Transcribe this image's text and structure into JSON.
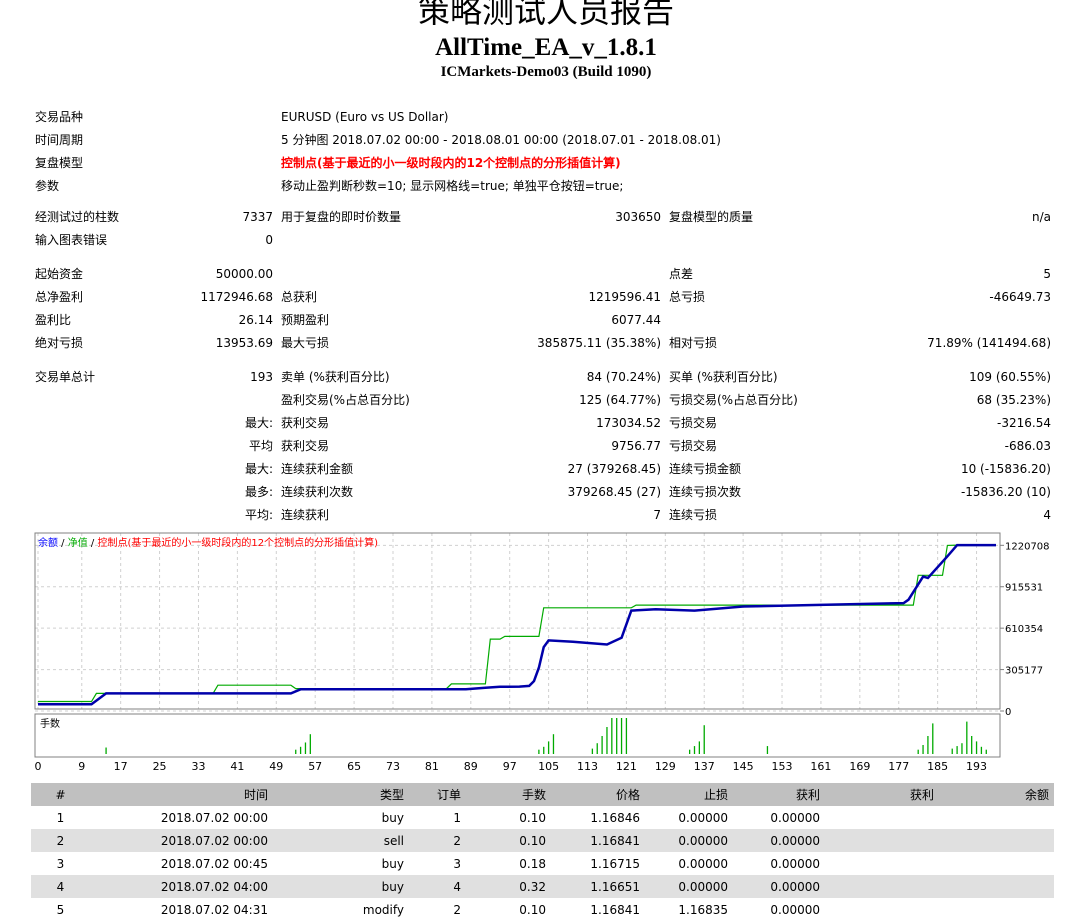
{
  "header": {
    "title": "策略测试人员报告",
    "ea_name": "AllTime_EA_v_1.8.1",
    "server": "ICMarkets-Demo03 (Build 1090)"
  },
  "info": {
    "symbol_label": "交易品种",
    "symbol_value": "EURUSD (Euro vs US Dollar)",
    "period_label": "时间周期",
    "period_value": "5 分钟图 2018.07.02 00:00 - 2018.08.01 00:00 (2018.07.01 - 2018.08.01)",
    "model_label": "复盘模型",
    "model_value": "控制点(基于最近的小一级时段内的12个控制点的分形插值计算)",
    "params_label": "参数",
    "params_value": "移动止盈判断秒数=10; 显示网格线=true; 单独平仓按钮=true;"
  },
  "stats": {
    "bars_label": "经测试过的柱数",
    "bars_value": "7337",
    "ticks_label": "用于复盘的即时价数量",
    "ticks_value": "303650",
    "quality_label": "复盘模型的质量",
    "quality_value": "n/a",
    "errors_label": "输入图表错误",
    "errors_value": "0",
    "deposit_label": "起始资金",
    "deposit_value": "50000.00",
    "spread_label": "点差",
    "spread_value": "5",
    "net_label": "总净盈利",
    "net_value": "1172946.68",
    "gross_profit_label": "总获利",
    "gross_profit_value": "1219596.41",
    "gross_loss_label": "总亏损",
    "gross_loss_value": "-46649.73",
    "pf_label": "盈利比",
    "pf_value": "26.14",
    "payoff_label": "预期盈利",
    "payoff_value": "6077.44",
    "abs_dd_label": "绝对亏损",
    "abs_dd_value": "13953.69",
    "max_dd_label": "最大亏损",
    "max_dd_value": "385875.11 (35.38%)",
    "rel_dd_label": "相对亏损",
    "rel_dd_value": "71.89% (141494.68)",
    "total_label": "交易单总计",
    "total_value": "193",
    "short_label": "卖单 (%获利百分比)",
    "short_value": "84 (70.24%)",
    "long_label": "买单 (%获利百分比)",
    "long_value": "109 (60.55%)",
    "profit_trades_label": "盈利交易(%占总百分比)",
    "profit_trades_value": "125 (64.77%)",
    "loss_trades_label": "亏损交易(%占总百分比)",
    "loss_trades_value": "68 (35.23%)",
    "largest_prefix": "最大:",
    "largest_profit_label": "获利交易",
    "largest_profit_value": "173034.52",
    "largest_loss_label": "亏损交易",
    "largest_loss_value": "-3216.54",
    "average_prefix": "平均",
    "average_profit_label": "获利交易",
    "average_profit_value": "9756.77",
    "average_loss_label": "亏损交易",
    "average_loss_value": "-686.03",
    "max_cons_prefix": "最大:",
    "max_cons_wins_label": "连续获利金额",
    "max_cons_wins_value": "27 (379268.45)",
    "max_cons_losses_label": "连续亏损金额",
    "max_cons_losses_value": "10 (-15836.20)",
    "maximal_prefix": "最多:",
    "maximal_wins_label": "连续获利次数",
    "maximal_wins_value": "379268.45 (27)",
    "maximal_losses_label": "连续亏损次数",
    "maximal_losses_value": "-15836.20 (10)",
    "avg_cons_prefix": "平均:",
    "avg_cons_wins_label": "连续获利",
    "avg_cons_wins_value": "7",
    "avg_cons_losses_label": "连续亏损",
    "avg_cons_losses_value": "4"
  },
  "chart_data": {
    "type": "line",
    "legend": [
      {
        "text": "余额",
        "color": "#0000ff"
      },
      {
        "text": "净值",
        "color": "#00aa00"
      },
      {
        "text": "控制点(基于最近的小一级时段内的12个控制点的分形插值计算)",
        "color": "#ff0000"
      }
    ],
    "legend_sep": " / ",
    "ylim": [
      0,
      1282000
    ],
    "y_ticks": [
      1220708,
      915531,
      610354,
      305177,
      0
    ],
    "xlim": [
      0,
      197
    ],
    "x_ticks": [
      0,
      9,
      17,
      25,
      33,
      41,
      49,
      57,
      65,
      73,
      81,
      89,
      97,
      105,
      113,
      121,
      129,
      137,
      145,
      153,
      161,
      169,
      177,
      185,
      193
    ],
    "colors": {
      "balance": "#0000aa",
      "equity": "#00aa00",
      "lots": "#00aa00"
    },
    "series": [
      {
        "name": "余额",
        "x": [
          0,
          11,
          14,
          52,
          54,
          88,
          92,
          95,
          99,
          101,
          102,
          103,
          104,
          105,
          110,
          117,
          120,
          122,
          127,
          135,
          145,
          178,
          179,
          182,
          183,
          187,
          189,
          197
        ],
        "y": [
          50000,
          50000,
          130000,
          130000,
          160000,
          160000,
          172000,
          178000,
          180000,
          185000,
          220000,
          320000,
          470000,
          520000,
          510000,
          490000,
          540000,
          740000,
          750000,
          740000,
          770000,
          795000,
          820000,
          990000,
          980000,
          1140000,
          1222000,
          1222000
        ]
      },
      {
        "name": "净值",
        "x": [
          0,
          2,
          11,
          12,
          36,
          37,
          52,
          53,
          84,
          85,
          92,
          93,
          95,
          96,
          103,
          104,
          122,
          123,
          180,
          181,
          186,
          187,
          189,
          197
        ],
        "y": [
          70000,
          70000,
          70000,
          130000,
          130000,
          190000,
          190000,
          165000,
          165000,
          200000,
          200000,
          530000,
          530000,
          550000,
          550000,
          760000,
          760000,
          780000,
          780000,
          1000000,
          1000000,
          1220000,
          1222000,
          1222000
        ]
      }
    ],
    "lots_label": "手数",
    "lots_bars": [
      {
        "x": 14,
        "v": 0.18
      },
      {
        "x": 53,
        "v": 0.12
      },
      {
        "x": 54,
        "v": 0.2
      },
      {
        "x": 55,
        "v": 0.32
      },
      {
        "x": 56,
        "v": 0.55
      },
      {
        "x": 103,
        "v": 0.12
      },
      {
        "x": 104,
        "v": 0.2
      },
      {
        "x": 105,
        "v": 0.35
      },
      {
        "x": 106,
        "v": 0.55
      },
      {
        "x": 114,
        "v": 0.15
      },
      {
        "x": 115,
        "v": 0.3
      },
      {
        "x": 116,
        "v": 0.5
      },
      {
        "x": 117,
        "v": 0.75
      },
      {
        "x": 118,
        "v": 1.0
      },
      {
        "x": 119,
        "v": 1.0
      },
      {
        "x": 120,
        "v": 1.0
      },
      {
        "x": 121,
        "v": 1.0
      },
      {
        "x": 134,
        "v": 0.12
      },
      {
        "x": 135,
        "v": 0.22
      },
      {
        "x": 136,
        "v": 0.35
      },
      {
        "x": 137,
        "v": 0.8
      },
      {
        "x": 150,
        "v": 0.22
      },
      {
        "x": 181,
        "v": 0.12
      },
      {
        "x": 182,
        "v": 0.25
      },
      {
        "x": 183,
        "v": 0.5
      },
      {
        "x": 184,
        "v": 0.85
      },
      {
        "x": 188,
        "v": 0.15
      },
      {
        "x": 189,
        "v": 0.22
      },
      {
        "x": 190,
        "v": 0.3
      },
      {
        "x": 191,
        "v": 0.9
      },
      {
        "x": 192,
        "v": 0.5
      },
      {
        "x": 193,
        "v": 0.35
      },
      {
        "x": 194,
        "v": 0.2
      },
      {
        "x": 195,
        "v": 0.12
      }
    ]
  },
  "trades": {
    "headers": [
      "#",
      "时间",
      "类型",
      "订单",
      "手数",
      "价格",
      "止损",
      "获利",
      "获利",
      "余额"
    ],
    "rows": [
      [
        "1",
        "2018.07.02 00:00",
        "buy",
        "1",
        "0.10",
        "1.16846",
        "0.00000",
        "0.00000",
        "",
        ""
      ],
      [
        "2",
        "2018.07.02 00:00",
        "sell",
        "2",
        "0.10",
        "1.16841",
        "0.00000",
        "0.00000",
        "",
        ""
      ],
      [
        "3",
        "2018.07.02 00:45",
        "buy",
        "3",
        "0.18",
        "1.16715",
        "0.00000",
        "0.00000",
        "",
        ""
      ],
      [
        "4",
        "2018.07.02 04:00",
        "buy",
        "4",
        "0.32",
        "1.16651",
        "0.00000",
        "0.00000",
        "",
        ""
      ],
      [
        "5",
        "2018.07.02 04:31",
        "modify",
        "2",
        "0.10",
        "1.16841",
        "1.16835",
        "0.00000",
        "",
        ""
      ]
    ]
  }
}
